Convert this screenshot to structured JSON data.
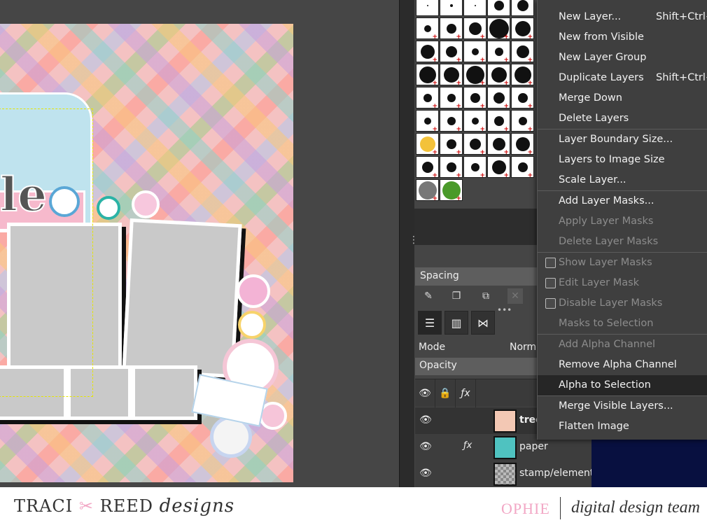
{
  "canvas": {
    "title_partial": "le"
  },
  "brushes": {
    "panel_label": "Spacing"
  },
  "layers_panel": {
    "mode_label": "Mode",
    "mode_value": "Norm",
    "opacity_label": "Opacity",
    "layers": [
      {
        "name": "tree",
        "bold": true,
        "has_fx": false,
        "thumb_color": "#f3c8b4"
      },
      {
        "name": "paper",
        "bold": false,
        "has_fx": true,
        "thumb_color": "#4fc2c0"
      },
      {
        "name": "stamp/element",
        "bold": false,
        "has_fx": false,
        "thumb_color": "checker"
      }
    ]
  },
  "context_menu": {
    "items": [
      {
        "label": "New Layer...",
        "shortcut": "Shift+Ctrl+",
        "disabled": false,
        "checkbox": false
      },
      {
        "label": "New from Visible",
        "shortcut": "",
        "disabled": false,
        "checkbox": false
      },
      {
        "label": "New Layer Group",
        "shortcut": "",
        "disabled": false,
        "checkbox": false
      },
      {
        "label": "Duplicate Layers",
        "shortcut": "Shift+Ctrl+",
        "disabled": false,
        "checkbox": false
      },
      {
        "label": "Merge Down",
        "shortcut": "",
        "disabled": false,
        "checkbox": false
      },
      {
        "label": "Delete Layers",
        "shortcut": "",
        "disabled": false,
        "checkbox": false
      },
      {
        "label": "Layer Boundary Size...",
        "shortcut": "",
        "disabled": false,
        "checkbox": false
      },
      {
        "label": "Layers to Image Size",
        "shortcut": "",
        "disabled": false,
        "checkbox": false
      },
      {
        "label": "Scale Layer...",
        "shortcut": "",
        "disabled": false,
        "checkbox": false
      },
      {
        "label": "Add Layer Masks...",
        "shortcut": "",
        "disabled": false,
        "checkbox": false
      },
      {
        "label": "Apply Layer Masks",
        "shortcut": "",
        "disabled": true,
        "checkbox": false
      },
      {
        "label": "Delete Layer Masks",
        "shortcut": "",
        "disabled": true,
        "checkbox": false
      },
      {
        "label": "Show Layer Masks",
        "shortcut": "",
        "disabled": true,
        "checkbox": true
      },
      {
        "label": "Edit Layer Mask",
        "shortcut": "",
        "disabled": true,
        "checkbox": true
      },
      {
        "label": "Disable Layer Masks",
        "shortcut": "",
        "disabled": true,
        "checkbox": true
      },
      {
        "label": "Masks to Selection",
        "shortcut": "",
        "disabled": true,
        "checkbox": false
      },
      {
        "label": "Add Alpha Channel",
        "shortcut": "",
        "disabled": true,
        "checkbox": false
      },
      {
        "label": "Remove Alpha Channel",
        "shortcut": "",
        "disabled": false,
        "checkbox": false
      },
      {
        "label": "Alpha to Selection",
        "shortcut": "",
        "disabled": false,
        "checkbox": false,
        "highlighted": true
      },
      {
        "label": "Merge Visible Layers...",
        "shortcut": "",
        "disabled": false,
        "checkbox": false
      },
      {
        "label": "Flatten Image",
        "shortcut": "",
        "disabled": false,
        "checkbox": false
      }
    ]
  },
  "footer": {
    "brand_left": "TRACI",
    "brand_mid": "REED",
    "brand_script": "designs",
    "ophie": "OPHIE",
    "team": "digital design team"
  },
  "colors": {
    "menu_bg": "#3f3f3f",
    "menu_highlight": "#262626",
    "accent_pink": "#f2a7c5"
  }
}
